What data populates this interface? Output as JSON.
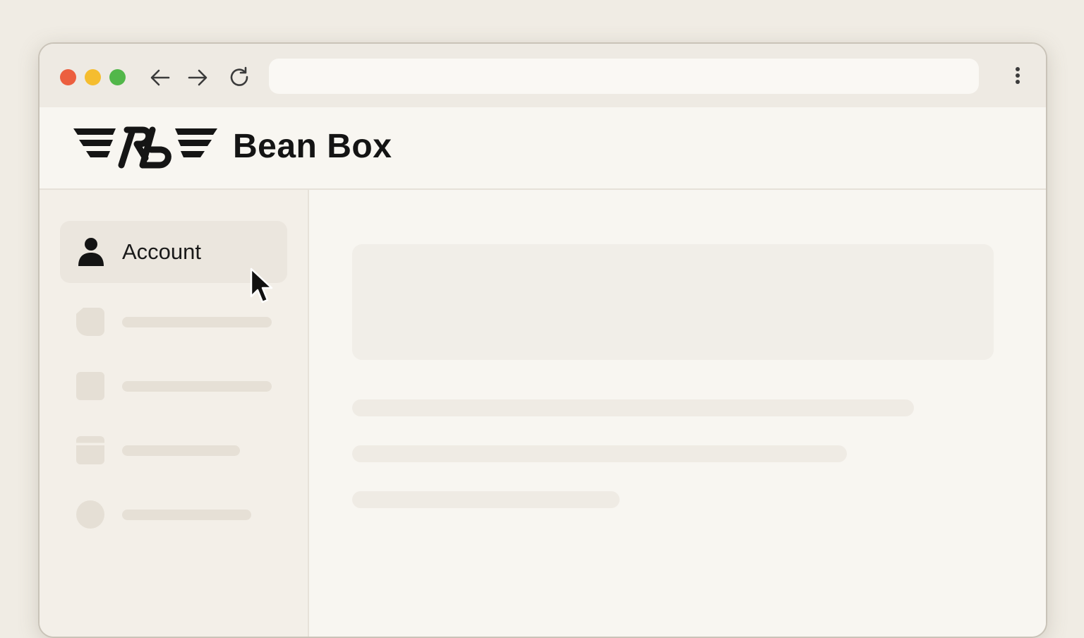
{
  "browser": {
    "controls": [
      "close",
      "minimize",
      "maximize"
    ],
    "nav_icons": [
      "back-arrow-icon",
      "forward-arrow-icon",
      "reload-icon"
    ],
    "address_bar": {
      "value": "",
      "placeholder": ""
    },
    "menu_icon": "more-vertical-icon"
  },
  "header": {
    "logo_icon": "winged-monogram-logo",
    "brand_name": "Bean Box"
  },
  "sidebar": {
    "active_item": {
      "label": "Account",
      "icon": "user-icon"
    },
    "placeholder_items": [
      {
        "icon": "document-placeholder-icon"
      },
      {
        "icon": "square-placeholder-icon"
      },
      {
        "icon": "box-placeholder-icon"
      },
      {
        "icon": "circle-placeholder-icon"
      }
    ]
  },
  "colors": {
    "page_background": "#f0ece4",
    "window_border": "#c9c3b8",
    "traffic_red": "#ec5f3f",
    "traffic_yellow": "#f5bd2f",
    "traffic_green": "#52b74a",
    "text_dark": "#141414",
    "placeholder": "#e6e0d6"
  }
}
